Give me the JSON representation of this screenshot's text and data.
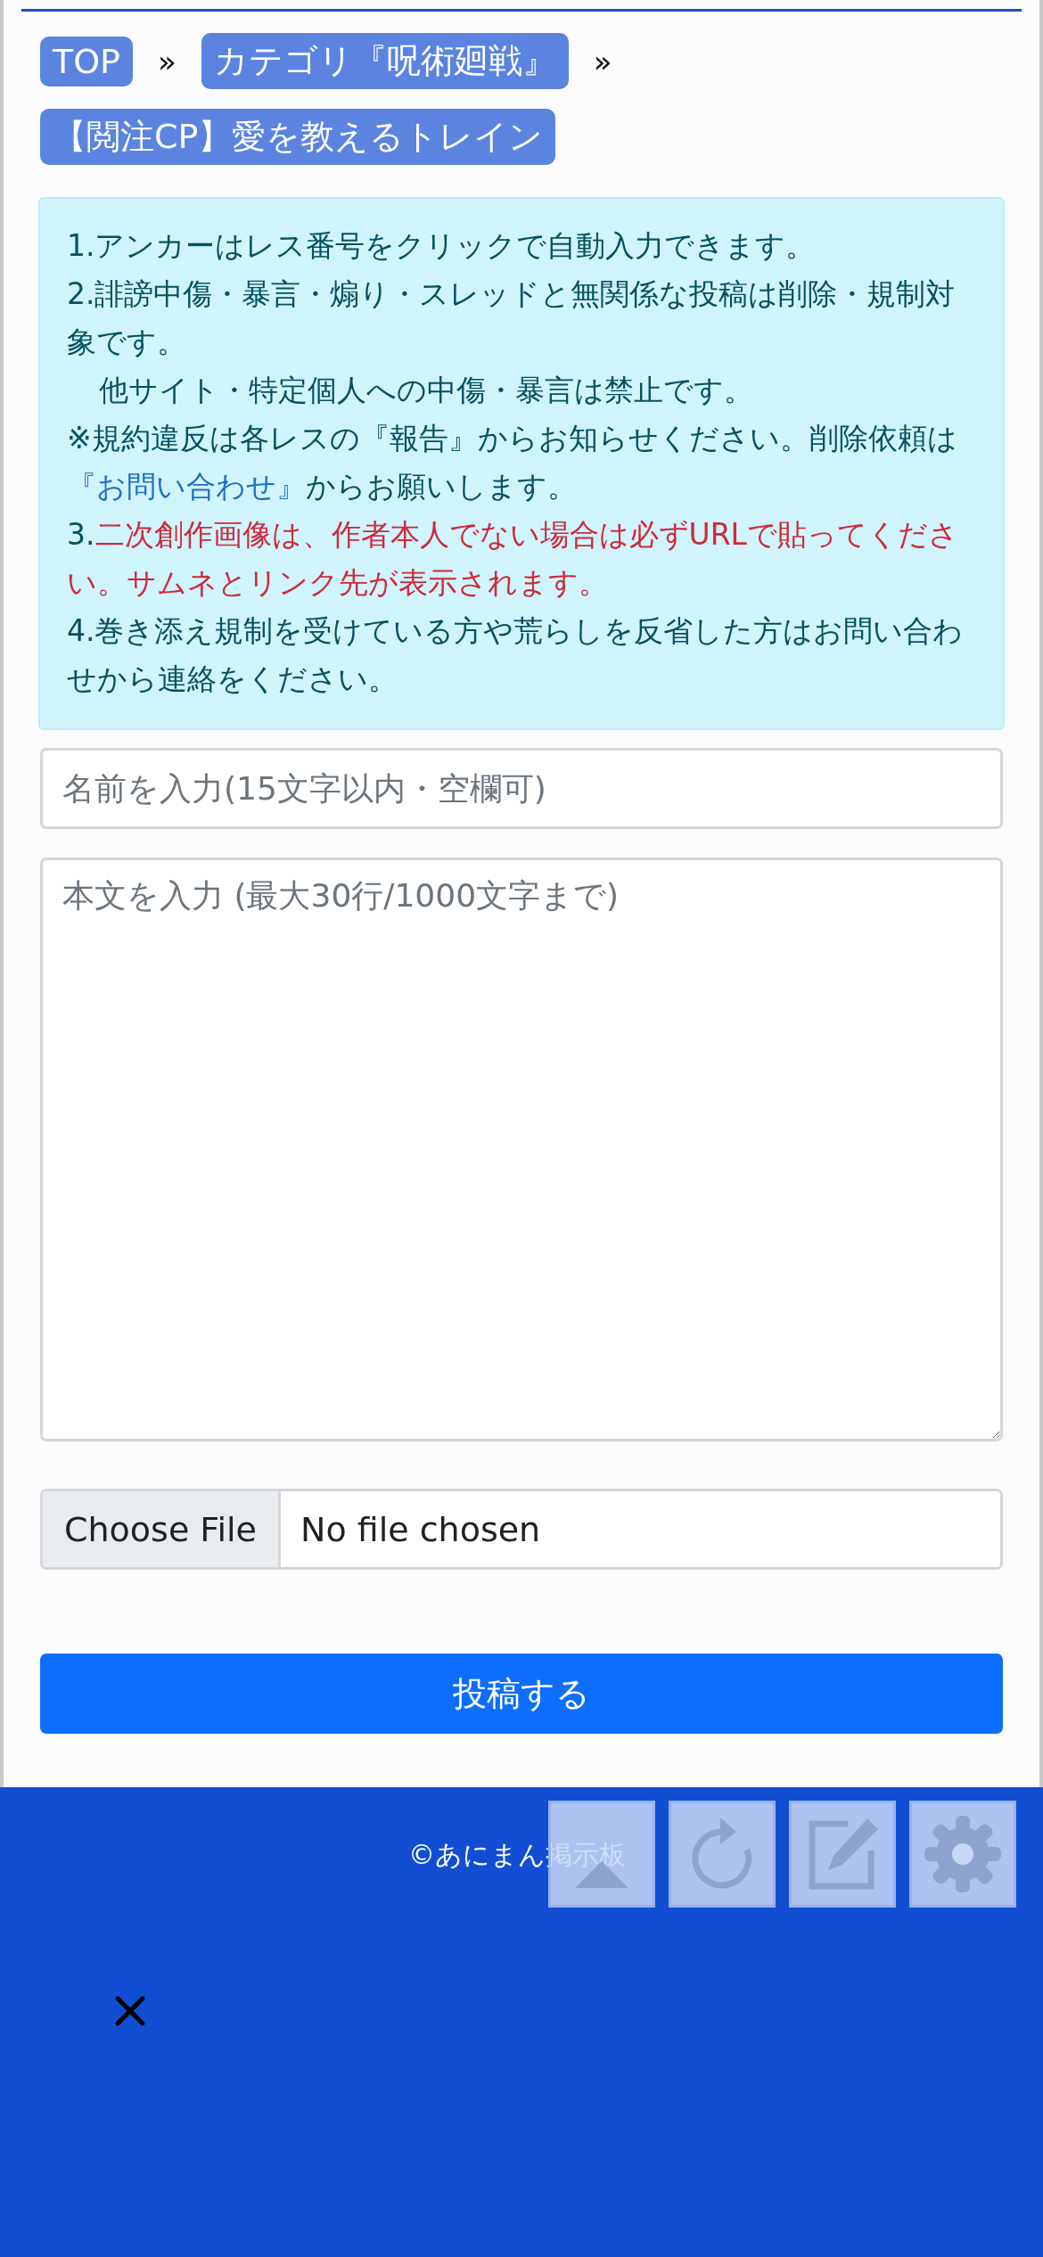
{
  "breadcrumbs": [
    {
      "kind": "link",
      "label": "TOP"
    },
    {
      "kind": "separator",
      "label": "»"
    },
    {
      "kind": "link",
      "label": "カテゴリ『呪術廻戦』"
    },
    {
      "kind": "separator",
      "label": "»"
    },
    {
      "kind": "link",
      "label": "【閲注CP】愛を教えるトレイン"
    }
  ],
  "notice": {
    "paragraphs": [
      {
        "kind": "plain",
        "text": "1.アンカーはレス番号をクリックで自動入力できます。"
      },
      {
        "kind": "plain",
        "text": "2.誹謗中傷・暴言・煽り・スレッドと無関係な投稿は削除・規制対象です。"
      },
      {
        "kind": "indent",
        "text": "他サイト・特定個人への中傷・暴言は禁止です。"
      },
      {
        "kind": "link",
        "before": "※規約違反は各レスの『報告』からお知らせください。削除依頼は",
        "link": "『お問い合わせ』",
        "after": "からお願いします。"
      },
      {
        "kind": "warning",
        "prefix": "3.",
        "text": "二次創作画像は、作者本人でない場合は必ずURLで貼ってください。サムネとリンク先が表示されます。"
      },
      {
        "kind": "plain",
        "text": "4.巻き添え規制を受けている方や荒らしを反省した方はお問い合わせから連絡をください。"
      }
    ]
  },
  "form": {
    "name": {
      "placeholder": "名前を入力(15文字以内・空欄可)"
    },
    "body": {
      "placeholder": "本文を入力 (最大30行/1000文字まで)"
    },
    "file": {
      "button": "Choose File",
      "status": "No file chosen"
    },
    "submit": "投稿する"
  },
  "footer": {
    "copyright": "©あにまん掲示板",
    "float_buttons": [
      {
        "kind": "top"
      },
      {
        "kind": "reload"
      },
      {
        "kind": "edit"
      },
      {
        "kind": "settings"
      }
    ]
  }
}
